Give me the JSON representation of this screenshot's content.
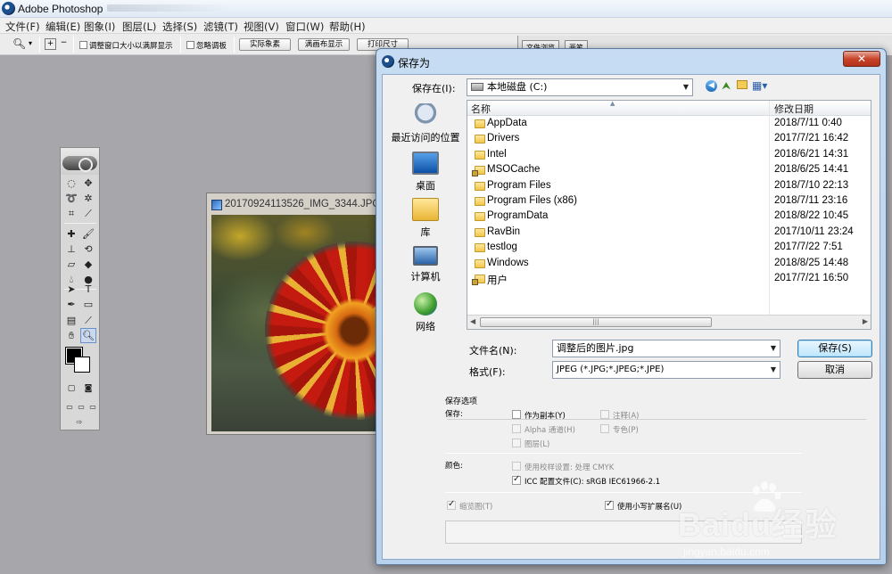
{
  "app": {
    "title": "Adobe Photoshop",
    "menus": [
      "文件(F)",
      "编辑(E)",
      "图象(I)",
      "图层(L)",
      "选择(S)",
      "滤镜(T)",
      "视图(V)",
      "窗口(W)",
      "帮助(H)"
    ]
  },
  "options_bar": {
    "zoom_arrow": "▾",
    "resize_window": "调整窗口大小以满屏显示",
    "ignore_palettes": "忽略调板",
    "actual_pixels": "实际象素",
    "fit_screen": "满画布显示",
    "print_size": "打印尺寸"
  },
  "right_panel": {
    "tabs": [
      "文件浏览",
      "画笔"
    ]
  },
  "document": {
    "title": "20170924113526_IMG_3344.JPG"
  },
  "dialog": {
    "title": "保存为",
    "close_label": "✕",
    "save_in_label": "保存在(I):",
    "save_in_value": "本地磁盘 (C:)",
    "places": [
      "最近访问的位置",
      "桌面",
      "库",
      "计算机",
      "网络"
    ],
    "columns": {
      "name": "名称",
      "modified": "修改日期"
    },
    "files": [
      {
        "name": "AppData",
        "date": "2018/7/11 0:40"
      },
      {
        "name": "Drivers",
        "date": "2017/7/21 16:42"
      },
      {
        "name": "Intel",
        "date": "2018/6/21 14:31"
      },
      {
        "name": "MSOCache",
        "date": "2018/6/25 14:41"
      },
      {
        "name": "Program Files",
        "date": "2018/7/10 22:13"
      },
      {
        "name": "Program Files (x86)",
        "date": "2018/7/11 23:16"
      },
      {
        "name": "ProgramData",
        "date": "2018/8/22 10:45"
      },
      {
        "name": "RavBin",
        "date": "2017/10/11 23:24"
      },
      {
        "name": "testlog",
        "date": "2017/7/22 7:51"
      },
      {
        "name": "Windows",
        "date": "2018/8/25 14:48"
      },
      {
        "name": "用户",
        "date": "2017/7/21 16:50"
      }
    ],
    "filename_label": "文件名(N):",
    "filename_value": "调整后的图片.jpg",
    "format_label": "格式(F):",
    "format_value": "JPEG (*.JPG;*.JPEG;*.JPE)",
    "save_button": "保存(S)",
    "cancel_button": "取消",
    "save_options": {
      "heading": "保存选项",
      "save_label": "保存:",
      "as_copy": "作为副本(Y)",
      "annotations": "注释(A)",
      "alpha_channels": "Alpha 通道(H)",
      "spot_colors": "专色(P)",
      "layers": "图层(L)",
      "color_label": "颜色:",
      "use_proof": "使用校样设置: 处理 CMYK",
      "icc_profile": "ICC 配置文件(C): sRGB IEC61966-2.1",
      "thumbnail": "缩览图(T)",
      "lowercase_ext": "使用小写扩展名(U)"
    }
  },
  "watermark": {
    "brand": "Baidu经验",
    "url": "jingyan.baidu.com"
  }
}
